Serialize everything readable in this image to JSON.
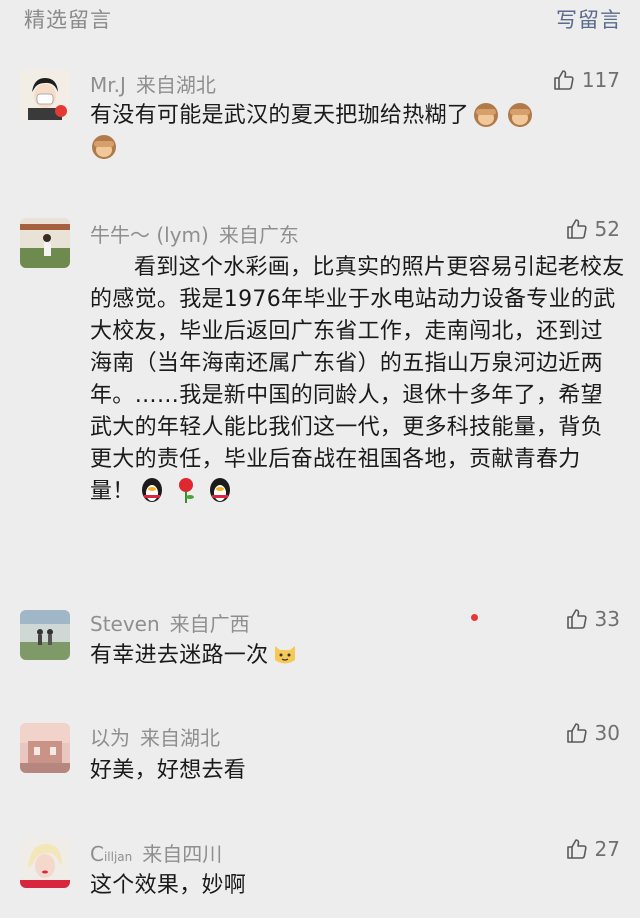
{
  "header": {
    "title": "精选留言",
    "write_label": "写留言"
  },
  "comments": [
    {
      "name": "Mr.J",
      "location": "来自湖北",
      "likes": "117",
      "text": "有没有可能是武汉的夏天把珈给热糊了"
    },
    {
      "name": "牛牛～ (lym)",
      "location": "来自广东",
      "likes": "52",
      "text": "看到这个水彩画，比真实的照片更容易引起老校友的感觉。我是1976年毕业于水电站动力设备专业的武大校友，毕业后返回广东省工作，走南闯北，还到过海南（当年海南还属广东省）的五指山万泉河边近两年。……我是新中国的同龄人，退休十多年了，希望武大的年轻人能比我们这一代，更多科技能量，背负更大的责任，毕业后奋战在祖国各地，贡献青春力量！"
    },
    {
      "name": "Steven",
      "location": "来自广西",
      "likes": "33",
      "text": "有幸进去迷路一次"
    },
    {
      "name": "以为",
      "location": "来自湖北",
      "likes": "30",
      "text": "好美，好想去看"
    },
    {
      "name_main": "C",
      "name_sub": "illjan",
      "location": "来自四川",
      "likes": "27",
      "text": "这个效果，妙啊"
    }
  ],
  "colors": {
    "background": "#ededed",
    "name": "#8f8f8f",
    "link": "#5b6b8c",
    "badge": "#e53935"
  },
  "icons": {
    "like": "thumbs-up-icon",
    "see_no_evil": "see-no-evil-monkey-emoji",
    "penguin": "qq-penguin-emoji",
    "rose": "rose-emoji",
    "cat": "cat-face-emoji"
  }
}
